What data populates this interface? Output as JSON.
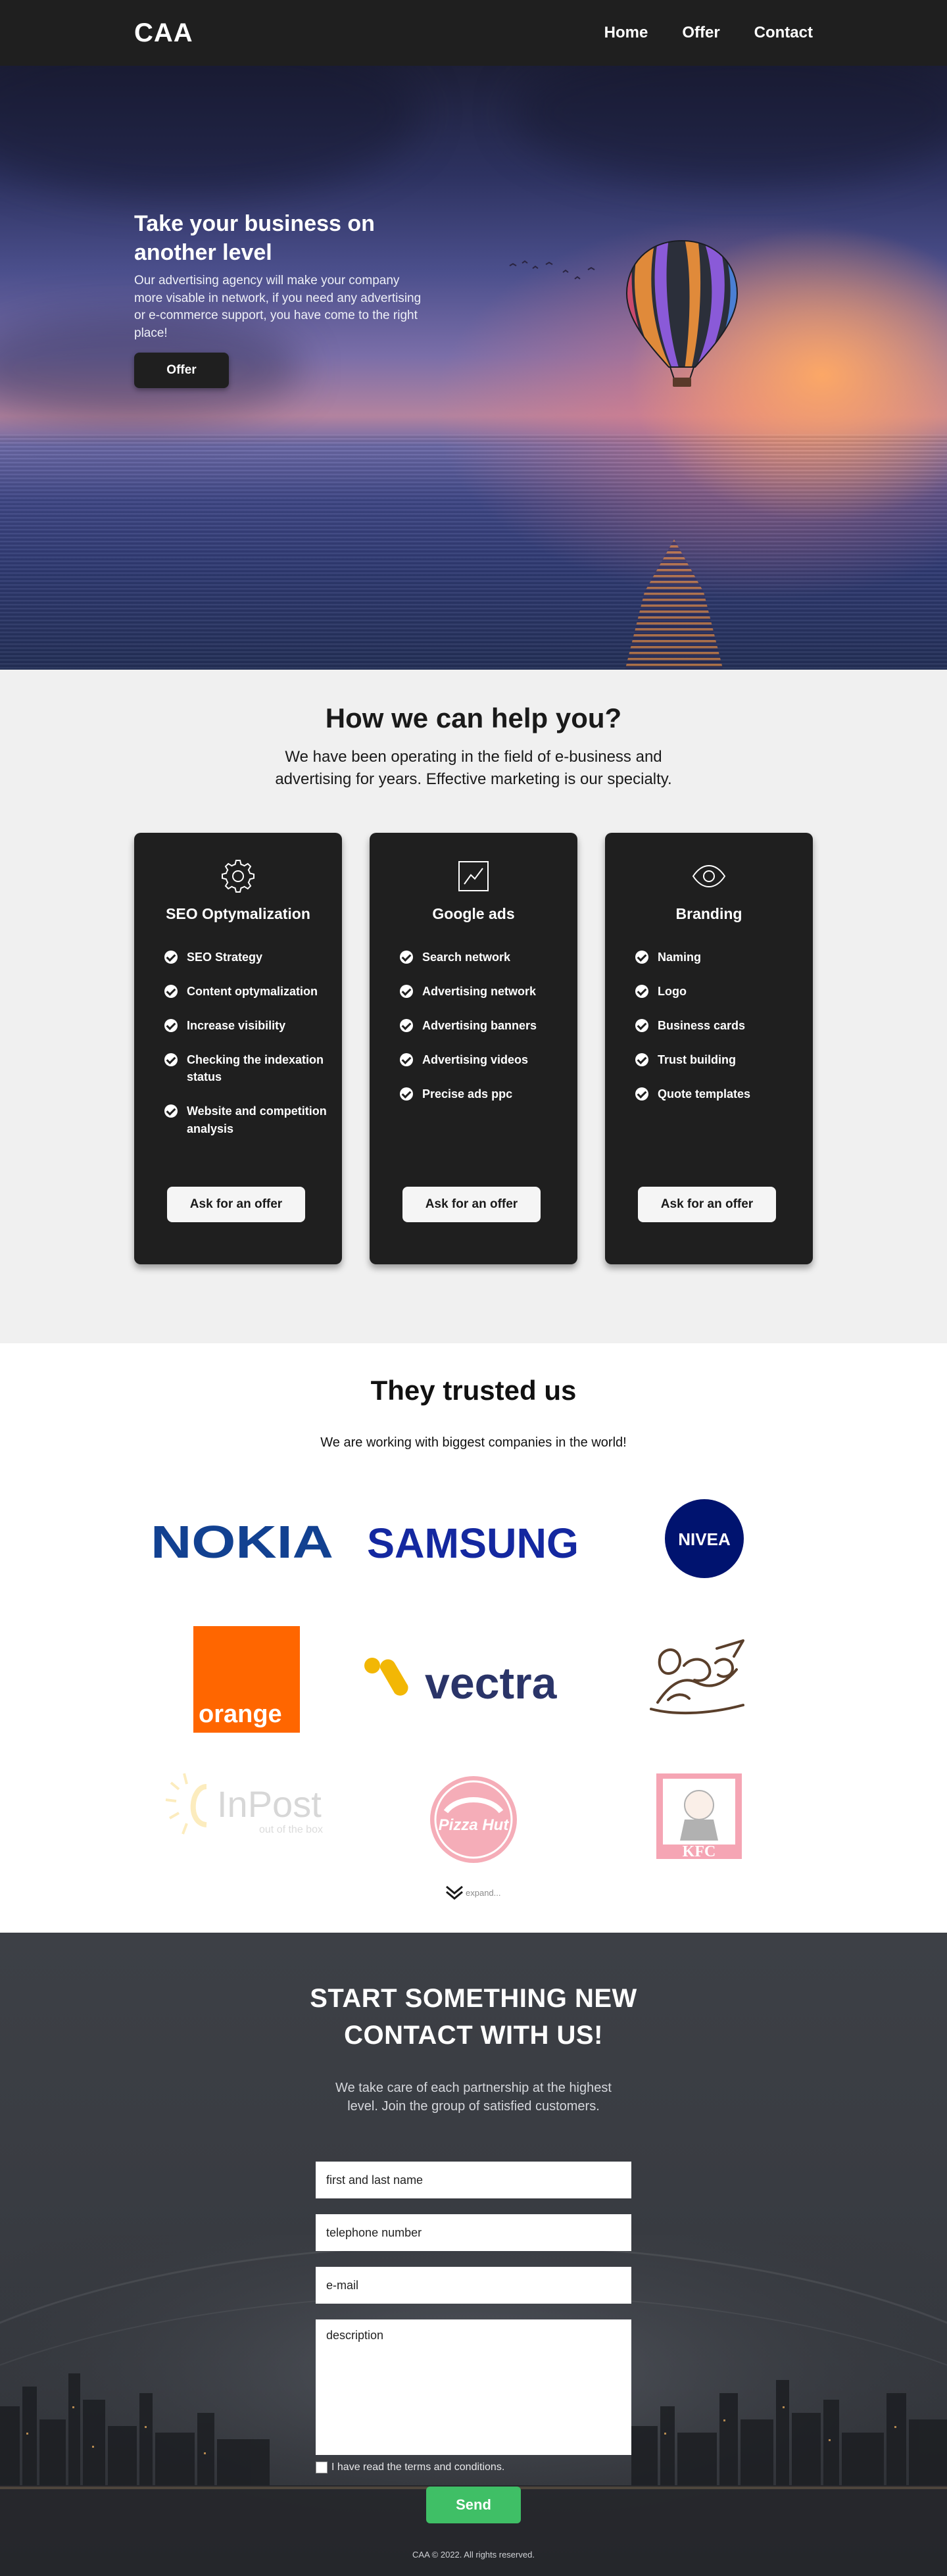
{
  "nav": {
    "brand": "CAA",
    "links": [
      "Home",
      "Offer",
      "Contact"
    ]
  },
  "hero": {
    "title": "Take your business on another level",
    "text": "Our advertising agency will make your company more visable in network, if you need any advertising or e-commerce support, you have come to the right place!",
    "button": "Offer"
  },
  "help": {
    "title": "How we can help you?",
    "subtitle": "We have been operating in the field of e-business and advertising for years. Effective marketing is our specialty.",
    "cards": [
      {
        "icon": "gear-icon",
        "title": "SEO Optymalization",
        "items": [
          "SEO Strategy",
          "Content optymalization",
          "Increase visibility",
          "Checking the indexation status",
          "Website and competition analysis"
        ],
        "button": "Ask for an offer"
      },
      {
        "icon": "chart-icon",
        "title": "Google ads",
        "items": [
          "Search network",
          "Advertising network",
          "Advertising banners",
          "Advertising videos",
          "Precise ads ppc"
        ],
        "button": "Ask for an offer"
      },
      {
        "icon": "eye-icon",
        "title": "Branding",
        "items": [
          "Naming",
          "Logo",
          "Business cards",
          "Trust building",
          "Quote templates"
        ],
        "button": "Ask for an offer"
      }
    ]
  },
  "trusted": {
    "title": "They trusted us",
    "subtitle": "We are working with biggest companies in the world!",
    "logos": {
      "nokia": "NOKIA",
      "samsung": "SAMSUNG",
      "nivea": "NIVEA",
      "orange": "orange",
      "vectra": "vectra",
      "inpost": "InPost",
      "inpost_tagline": "out of the box",
      "pizzahut": "Pizza Hut",
      "kfc": "KFC"
    },
    "expand": "expand..."
  },
  "contact": {
    "title_line1": "START SOMETHING NEW",
    "title_line2": "CONTACT WITH US!",
    "subtitle": "We take care of each partnership at the highest level. Join the group of satisfied customers.",
    "fields": {
      "name": "first and last name",
      "phone": "telephone number",
      "email": "e-mail",
      "description": "description"
    },
    "terms": "I have read the terms and conditions.",
    "send": "Send"
  },
  "footer": "CAA © 2022. All rights reserved.",
  "colors": {
    "dark": "#1f1f1f",
    "light_section": "#f0f0f0",
    "send_green": "#3fbf66",
    "nokia_blue": "#124191",
    "samsung_blue": "#1428a0",
    "nivea_blue": "#00136f",
    "orange": "#ff6600",
    "vectra_yellow": "#f2b705",
    "vectra_navy": "#2a3468"
  }
}
